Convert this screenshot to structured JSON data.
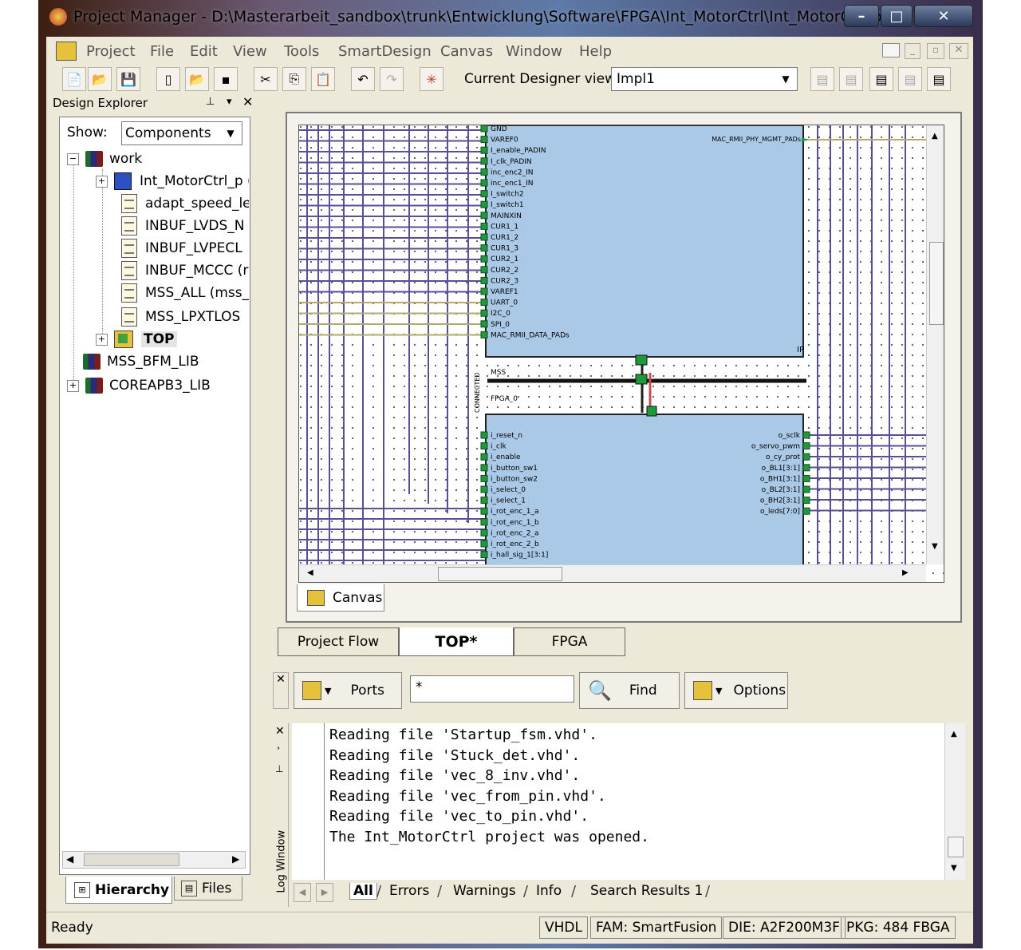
{
  "window": {
    "title": "Project Manager - D:\\Masterarbeit_sandbox\\trunk\\Entwicklung\\Software\\FPGA\\Int_MotorCtrl\\Int_MotorCtrl.prj -...",
    "controls": [
      "–",
      "□",
      "✕"
    ]
  },
  "menu": [
    "Project",
    "File",
    "Edit",
    "View",
    "Tools",
    "SmartDesign",
    "Canvas",
    "Window",
    "Help"
  ],
  "toolbar": {
    "designer_label": "Current Designer view:",
    "designer_value": "Impl1"
  },
  "design_explorer": {
    "title": "Design Explorer",
    "show_label": "Show:",
    "show_value": "Components",
    "tree": [
      {
        "label": "work",
        "level": 0,
        "icon": "library-icon"
      },
      {
        "label": "Int_MotorCtrl_p (",
        "level": 1,
        "icon": "component-icon"
      },
      {
        "label": "adapt_speed_le",
        "level": 1,
        "icon": "document-icon"
      },
      {
        "label": "INBUF_LVDS_N",
        "level": 1,
        "icon": "document-icon"
      },
      {
        "label": "INBUF_LVPECL",
        "level": 1,
        "icon": "document-icon"
      },
      {
        "label": "INBUF_MCCC (r",
        "level": 1,
        "icon": "document-icon"
      },
      {
        "label": "MSS_ALL (mss_",
        "level": 1,
        "icon": "document-icon"
      },
      {
        "label": "MSS_LPXTLOS",
        "level": 1,
        "icon": "document-icon"
      },
      {
        "label": "TOP",
        "level": 1,
        "icon": "top-icon"
      },
      {
        "label": "MSS_BFM_LIB",
        "level": 0,
        "icon": "library-icon"
      },
      {
        "label": "COREAPB3_LIB",
        "level": 0,
        "icon": "library-icon"
      }
    ],
    "tabs": [
      "Hierarchy",
      "Files"
    ]
  },
  "canvas": {
    "tab_label": "Canvas",
    "upper_block_pins": [
      "GND",
      "VAREF0",
      "I_enable_PADIN",
      "I_clk_PADIN",
      "inc_enc2_IN",
      "inc_enc1_IN",
      "I_switch2",
      "I_switch1",
      "MAINXIN",
      "CUR1_1",
      "CUR1_2",
      "CUR1_3",
      "CUR2_1",
      "CUR2_2",
      "CUR2_3",
      "VAREF1",
      "UART_0",
      "I2C_0",
      "SPI_0",
      "MAC_RMII_DATA_PADs"
    ],
    "upper_block_right": "MAC_RMII_PHY_MGMT_PADs",
    "connector_labels": [
      "MSS",
      "FPGA_0",
      "CONNECTED"
    ],
    "lower_block_pins_left": [
      "i_reset_n",
      "i_clk",
      "i_enable",
      "i_button_sw1",
      "i_button_sw2",
      "i_select_0",
      "i_select_1",
      "i_rot_enc_1_a",
      "i_rot_enc_1_b",
      "i_rot_enc_2_a",
      "i_rot_enc_2_b",
      "i_hall_sig_1[3:1]"
    ],
    "lower_block_pins_right": [
      "o_sclk",
      "o_servo_pwm",
      "o_cy_prot",
      "o_BL1[3:1]",
      "o_BH1[3:1]",
      "o_BL2[3:1]",
      "o_BH2[3:1]",
      "o_leds[7:0]"
    ]
  },
  "editor_tabs": [
    "Project Flow",
    "TOP*",
    "FPGA"
  ],
  "find_bar": {
    "ports_label": "Ports",
    "find_value": "*",
    "find_label": "Find",
    "options_label": "Options"
  },
  "log": {
    "side_label": "Log Window",
    "lines": [
      "Reading file 'Startup_fsm.vhd'.",
      "Reading file 'Stuck_det.vhd'.",
      "Reading file 'vec_8_inv.vhd'.",
      "Reading file 'vec_from_pin.vhd'.",
      "Reading file 'vec_to_pin.vhd'.",
      "The Int_MotorCtrl project was opened."
    ],
    "tabs": [
      "All",
      "Errors",
      "Warnings",
      "Info",
      "Search Results 1"
    ]
  },
  "status": {
    "text": "Ready",
    "lang": "VHDL",
    "fam": "FAM: SmartFusion",
    "die": "DIE: A2F200M3F",
    "pkg": "PKG: 484 FBGA"
  },
  "colors": {
    "block_fill": "#a9c9e6",
    "wire_purple": "#5c4e96",
    "wire_olive": "#b3ab6a",
    "pin_green": "#1f9a3a"
  }
}
